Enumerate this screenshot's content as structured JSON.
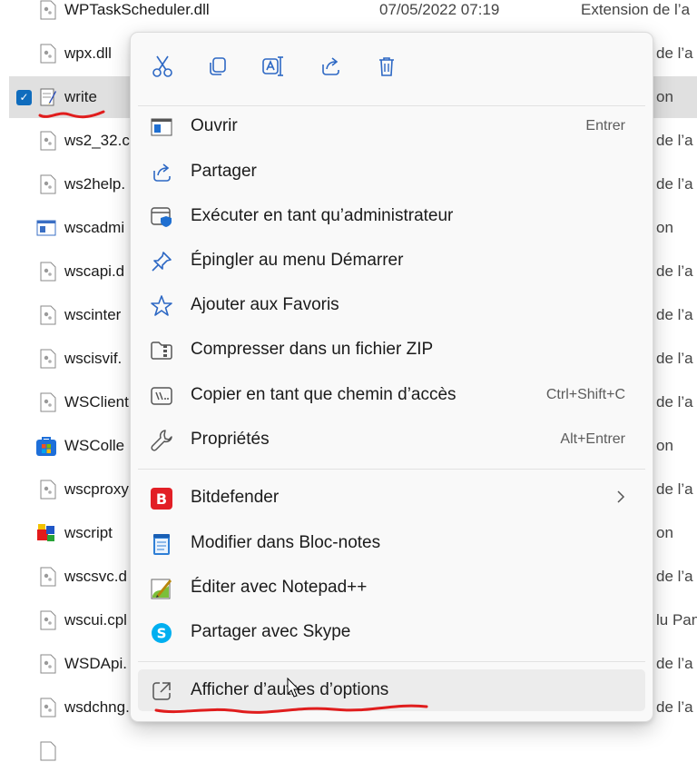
{
  "file_list": {
    "rows": [
      {
        "name": "WPTaskScheduler.dll",
        "date": "07/05/2022 07:19",
        "type": "Extension de l’a",
        "icon": "dll-file-icon"
      },
      {
        "name": "wpx.dll",
        "type_tail": "de l’a",
        "icon": "dll-file-icon"
      },
      {
        "name": "write",
        "type_tail": "on",
        "icon": "write-app-icon",
        "selected": true
      },
      {
        "name": "ws2_32.c",
        "type_tail": "de l’a",
        "icon": "dll-file-icon"
      },
      {
        "name": "ws2help.",
        "type_tail": "de l’a",
        "icon": "dll-file-icon"
      },
      {
        "name": "wscadmi",
        "type_tail": "on",
        "icon": "app-window-icon"
      },
      {
        "name": "wscapi.d",
        "type_tail": "de l’a",
        "icon": "dll-file-icon"
      },
      {
        "name": "wscinter",
        "type_tail": "de l’a",
        "icon": "dll-file-icon"
      },
      {
        "name": "wscisvif.",
        "type_tail": "de l’a",
        "icon": "dll-file-icon"
      },
      {
        "name": "WSClient",
        "type_tail": "de l’a",
        "icon": "dll-file-icon"
      },
      {
        "name": "WSColle",
        "type_tail": "on",
        "icon": "store-app-icon"
      },
      {
        "name": "wscproxy",
        "type_tail": "de l’a",
        "icon": "dll-file-icon"
      },
      {
        "name": "wscript",
        "type_tail": "on",
        "icon": "script-host-icon"
      },
      {
        "name": "wscsvc.d",
        "type_tail": "de l’a",
        "icon": "dll-file-icon"
      },
      {
        "name": "wscui.cpl",
        "type_tail": "lu Pan",
        "icon": "dll-file-icon"
      },
      {
        "name": "WSDApi.",
        "type_tail": "de l’a",
        "icon": "dll-file-icon"
      },
      {
        "name": "wsdchng.",
        "type_tail": "de l’a",
        "icon": "dll-file-icon"
      }
    ]
  },
  "context_menu": {
    "quick_actions": [
      {
        "id": "cut",
        "icon": "scissors-icon"
      },
      {
        "id": "copy",
        "icon": "copy-icon"
      },
      {
        "id": "rename",
        "icon": "rename-icon"
      },
      {
        "id": "share",
        "icon": "share-icon"
      },
      {
        "id": "delete",
        "icon": "trash-icon"
      }
    ],
    "items": [
      {
        "label": "Ouvrir",
        "shortcut": "Entrer",
        "icon": "open-window-icon"
      },
      {
        "label": "Partager",
        "icon": "share-icon"
      },
      {
        "label": "Exécuter en tant qu’administrateur",
        "icon": "admin-shield-icon"
      },
      {
        "label": "Épingler au menu Démarrer",
        "icon": "pin-icon"
      },
      {
        "label": "Ajouter aux Favoris",
        "icon": "star-icon"
      },
      {
        "label": "Compresser dans un fichier ZIP",
        "icon": "zip-folder-icon"
      },
      {
        "label": "Copier en tant que chemin d’accès",
        "shortcut": "Ctrl+Shift+C",
        "icon": "copy-path-icon"
      },
      {
        "label": "Propriétés",
        "shortcut": "Alt+Entrer",
        "icon": "wrench-icon"
      },
      {
        "label": "Bitdefender",
        "icon": "bitdefender-icon",
        "submenu": true
      },
      {
        "label": "Modifier dans Bloc-notes",
        "icon": "notepad-icon"
      },
      {
        "label": "Éditer avec Notepad++",
        "icon": "notepad-plus-plus-icon"
      },
      {
        "label": "Partager avec Skype",
        "icon": "skype-icon"
      },
      {
        "label": "Afficher d’autres d’options",
        "icon": "more-options-icon",
        "hover": true
      }
    ]
  },
  "colors": {
    "accent": "#0f6cbd",
    "bitdefender": "#e21f26",
    "skype": "#00aff0",
    "annotation": "#e01d1d"
  }
}
